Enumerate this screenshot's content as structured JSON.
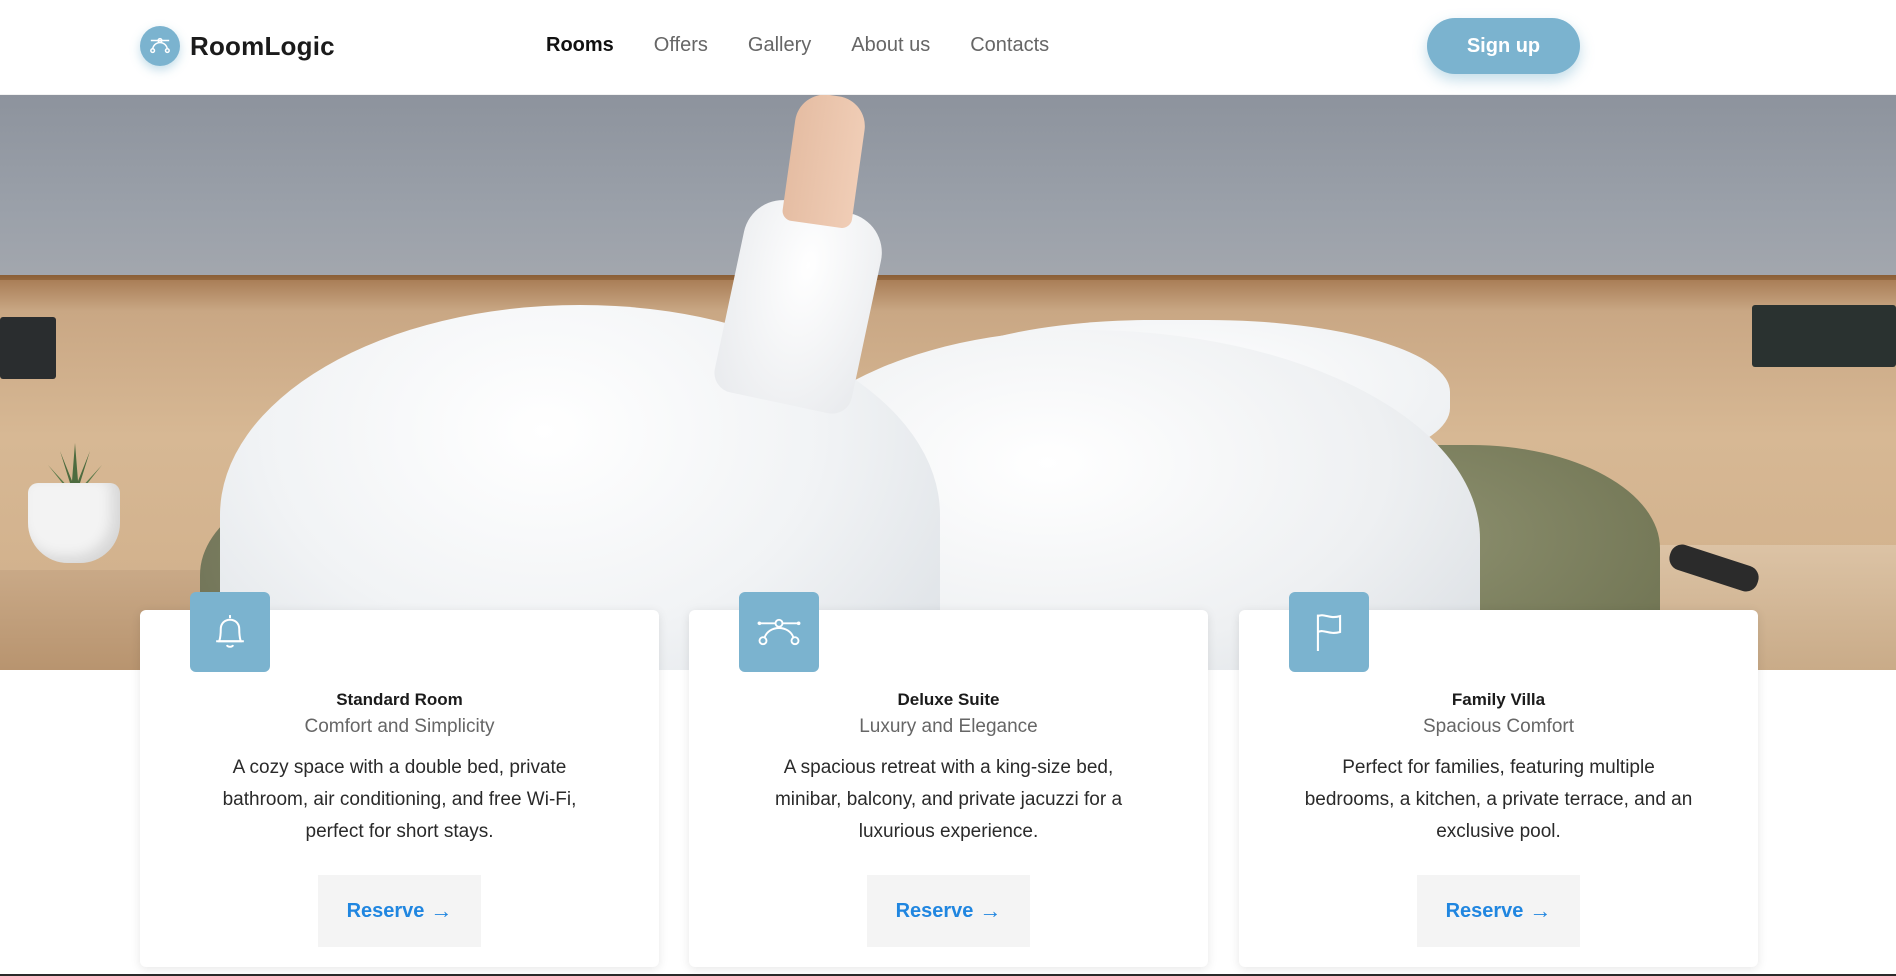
{
  "brand": {
    "name": "RoomLogic",
    "icon": "bezier-curve-icon",
    "accent": "#7bb3cf"
  },
  "nav": {
    "items": [
      {
        "label": "Rooms",
        "active": true
      },
      {
        "label": "Offers",
        "active": false
      },
      {
        "label": "Gallery",
        "active": false
      },
      {
        "label": "About us",
        "active": false
      },
      {
        "label": "Contacts",
        "active": false
      }
    ]
  },
  "header": {
    "signup_label": "Sign up"
  },
  "hero": {
    "image": "bedroom-hero-photo"
  },
  "cards": [
    {
      "icon": "bell-icon",
      "title": "Standard Room",
      "subtitle": "Comfort and Simplicity",
      "description": "A cozy space with a double bed, private bathroom, air conditioning, and free Wi-Fi, perfect for short stays.",
      "cta": "Reserve",
      "cta_arrow": "→"
    },
    {
      "icon": "bezier-curve-icon",
      "title": "Deluxe Suite",
      "subtitle": "Luxury and Elegance",
      "description": "A spacious retreat with a king-size bed, minibar, balcony, and private jacuzzi for a luxurious experience.",
      "cta": "Reserve",
      "cta_arrow": "→"
    },
    {
      "icon": "flag-icon",
      "title": "Family Villa",
      "subtitle": "Spacious Comfort",
      "description": "Perfect for families, featuring multiple bedrooms, a kitchen, a private terrace, and an exclusive pool.",
      "cta": "Reserve",
      "cta_arrow": "→"
    }
  ],
  "colors": {
    "link": "#2086e0",
    "button_bg": "#f4f4f4"
  }
}
